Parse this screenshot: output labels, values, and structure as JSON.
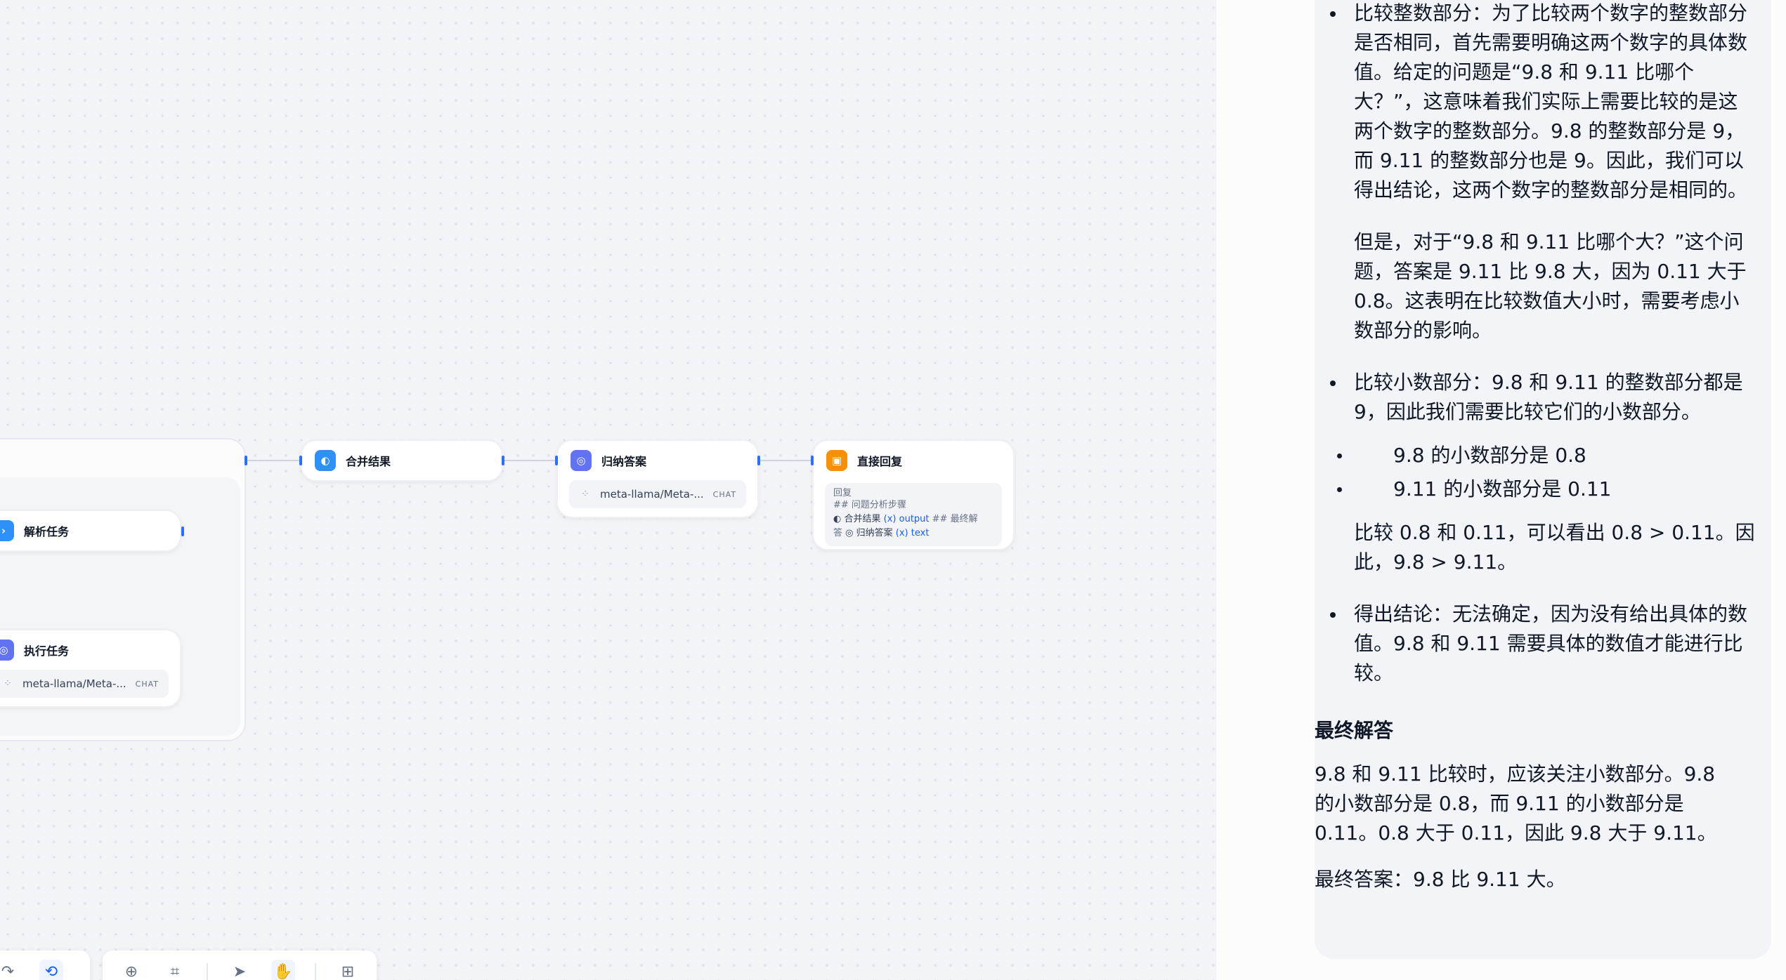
{
  "canvas": {
    "nodes": {
      "merge": {
        "title": "合并结果"
      },
      "summarize": {
        "title": "归纳答案",
        "model": "meta-llama/Meta-...",
        "tag": "CHAT"
      },
      "reply": {
        "title": "直接回复",
        "label": "回复",
        "line1": "## 问题分析步骤",
        "ref1_node": "合并结果",
        "ref1_var": "output",
        "line2_tail": "## 最终解",
        "line3_head": "答",
        "ref2_node": "归纳答案",
        "ref2_var": "text"
      },
      "parse": {
        "title": "解析任务"
      },
      "execute": {
        "title": "执行任务",
        "model": "meta-llama/Meta-...",
        "tag": "CHAT"
      }
    },
    "colors": {
      "merge": "#2e90fa",
      "summarize": "#6172f3",
      "reply": "#f79009",
      "parse": "#2e90fa",
      "execute": "#6172f3",
      "edge": "#d0d5dd",
      "handle": "#2970ff"
    },
    "toolbar": {
      "left_icons": [
        "redo-icon",
        "history-icon"
      ],
      "right_icons": [
        "add-node-icon",
        "note-icon",
        "pointer-icon",
        "hand-icon",
        "layout-icon"
      ]
    }
  },
  "answer": {
    "bullet1_text": "比较整数部分：为了比较两个数字的整数部分是否相同，首先需要明确这两个数字的具体数值。给定的问题是“9.8 和 9.11 比哪个大？”，这意味着我们实际上需要比较的是这两个数字的整数部分。9.8 的整数部分是 9，而 9.11 的整数部分也是 9。因此，我们可以得出结论，这两个数字的整数部分是相同的。",
    "bullet1_para2": "但是，对于“9.8 和 9.11 比哪个大？”这个问题，答案是 9.11 比 9.8 大，因为 0.11 大于 0.8。这表明在比较数值大小时，需要考虑小数部分的影响。",
    "bullet2_text": "比较小数部分：9.8 和 9.11 的整数部分都是 9，因此我们需要比较它们的小数部分。",
    "bullet2_sub1": "9.8 的小数部分是 0.8",
    "bullet2_sub2": "9.11 的小数部分是 0.11",
    "bullet2_para2": "比较 0.8 和 0.11，可以看出 0.8 > 0.11。因此，9.8 > 9.11。",
    "bullet3_text": "得出结论：无法确定，因为没有给出具体的数值。9.8 和 9.11 需要具体的数值才能进行比较。",
    "final_heading": "最终解答",
    "final_para": "9.8 和 9.11 比较时，应该关注小数部分。9.8 的小数部分是 0.8，而 9.11 的小数部分是 0.11。0.8 大于 0.11，因此 9.8 大于 9.11。",
    "final_answer": "最终答案：9.8 比 9.11 大。"
  }
}
